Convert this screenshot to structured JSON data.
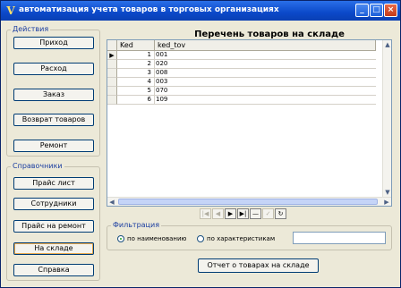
{
  "window": {
    "title": "автоматизация учета товаров в торговых организациях",
    "icon": "V",
    "controls": [
      "_",
      "□",
      "×"
    ]
  },
  "actions_group": {
    "label": "Действия",
    "buttons": [
      "Приход",
      "Расход",
      "Заказ",
      "Возврат товаров",
      "Ремонт"
    ]
  },
  "reference_group": {
    "label": "Справочники",
    "buttons": [
      "Прайс лист",
      "Сотрудники",
      "Прайс на ремонт",
      "На складе",
      "Справка"
    ]
  },
  "main": {
    "title": "Перечень товаров на складе",
    "grid": {
      "columns": [
        "Ked",
        "ked_tov"
      ],
      "current_row_indicator": "▶",
      "rows": [
        {
          "ked": "1",
          "ked_tov": "001"
        },
        {
          "ked": "2",
          "ked_tov": "020"
        },
        {
          "ked": "3",
          "ked_tov": "008"
        },
        {
          "ked": "4",
          "ked_tov": "003"
        },
        {
          "ked": "5",
          "ked_tov": "070"
        },
        {
          "ked": "6",
          "ked_tov": "109"
        }
      ]
    },
    "navigator": [
      "|◀",
      "◀",
      "▶",
      "▶|",
      "—",
      "✓",
      "↻"
    ],
    "filter": {
      "label": "Фильтрация",
      "option_name": "по наименованию",
      "option_spec": "по характеристикам",
      "selected": "по наименованию",
      "value": ""
    },
    "report_button": "Отчет о товарах на складе"
  },
  "colors": {
    "titlebar": "#0b49c9",
    "window_bg": "#ece9d8",
    "group_label": "#1a3da0"
  }
}
